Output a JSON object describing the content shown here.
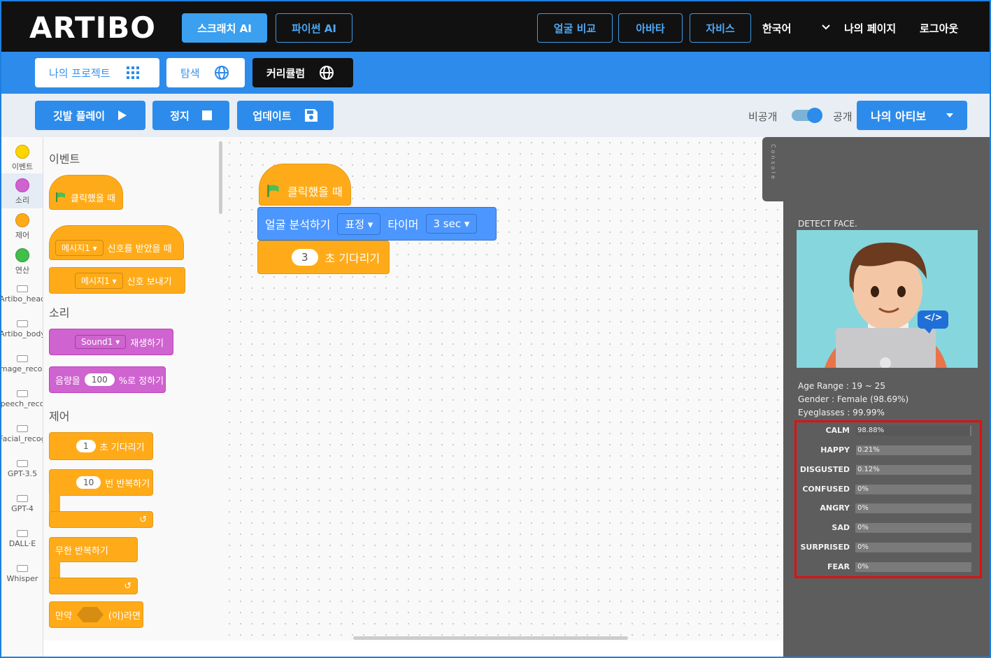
{
  "header": {
    "logo": "ARTIBO",
    "nav_left": [
      {
        "label": "스크래치 AI"
      },
      {
        "label": "파이썬 AI"
      }
    ],
    "nav_right": [
      {
        "label": "얼굴 비교"
      },
      {
        "label": "아바타"
      },
      {
        "label": "자비스"
      }
    ],
    "language": "한국어",
    "my_page": "나의 페이지",
    "logout": "로그아웃"
  },
  "subnav": {
    "my_projects": "나의 프로젝트",
    "explore": "탐색",
    "curriculum": "커리큘럼"
  },
  "toolbar": {
    "play": "깃발 플레이",
    "stop": "정지",
    "update": "업데이트",
    "private_label": "비공개",
    "public_label": "공개",
    "artibo_select": "나의 아티보"
  },
  "categories": [
    {
      "label": "이벤트",
      "color": "#ffd500"
    },
    {
      "label": "소리",
      "color": "#cf63cf"
    },
    {
      "label": "제어",
      "color": "#ffab19"
    },
    {
      "label": "연산",
      "color": "#40bf4a"
    },
    {
      "label": "Artibo_head"
    },
    {
      "label": "Artibo_body"
    },
    {
      "label": "Image_recog"
    },
    {
      "label": "Speech_recog"
    },
    {
      "label": "Facial_recog"
    },
    {
      "label": "GPT-3.5"
    },
    {
      "label": "GPT-4"
    },
    {
      "label": "DALL·E"
    },
    {
      "label": "Whisper"
    }
  ],
  "palette": {
    "events_title": "이벤트",
    "when_clicked": "클릭했을 때",
    "message1": "메시지1",
    "when_received": "신호를 받았을 때",
    "message1b": "메시지1",
    "send_signal": "신호 보내기",
    "sound_title": "소리",
    "sound1": "Sound1",
    "play_sound": "재생하기",
    "volume_prefix": "음량을",
    "volume_value": "100",
    "volume_suffix": "%로 정하기",
    "control_title": "제어",
    "wait_value": "1",
    "wait_label": "초 기다리기",
    "repeat_value": "10",
    "repeat_label": "번 반복하기",
    "forever_label": "무한 반복하기",
    "if_prefix": "만약",
    "if_suffix": "(이)라면"
  },
  "workspace": {
    "hat_label": "클릭했을 때",
    "analyze_label": "얼굴 분석하기",
    "analyze_mode": "표정",
    "timer_label": "타이머",
    "timer_value": "3 sec",
    "wait_value": "3",
    "wait_label": "초 기다리기"
  },
  "panel": {
    "console_tab": "Console",
    "detect_title": "DETECT FACE.",
    "age_range": "Age Range : 19 ~ 25",
    "gender": "Gender : Female (98.69%)",
    "eyeglasses": "Eyeglasses : 99.99%",
    "code_badge": "</>",
    "emotions": [
      {
        "name": "CALM",
        "value": "98.88%",
        "fraction": 0.9888
      },
      {
        "name": "HAPPY",
        "value": "0.21%",
        "fraction": 0.0021
      },
      {
        "name": "DISGUSTED",
        "value": "0.12%",
        "fraction": 0.0012
      },
      {
        "name": "CONFUSED",
        "value": "0%",
        "fraction": 0
      },
      {
        "name": "ANGRY",
        "value": "0%",
        "fraction": 0
      },
      {
        "name": "SAD",
        "value": "0%",
        "fraction": 0
      },
      {
        "name": "SURPRISED",
        "value": "0%",
        "fraction": 0
      },
      {
        "name": "FEAR",
        "value": "0%",
        "fraction": 0
      }
    ]
  }
}
